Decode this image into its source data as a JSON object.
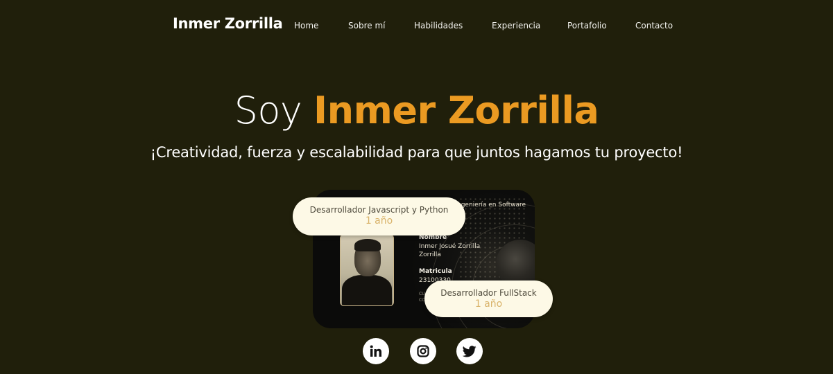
{
  "header": {
    "brand": "Inmer Zorrilla",
    "nav": [
      {
        "label": "Home"
      },
      {
        "label": "Sobre mí"
      },
      {
        "label": "Habilidades"
      },
      {
        "label": "Experiencia"
      },
      {
        "label": "Portafolio"
      },
      {
        "label": "Contacto"
      }
    ]
  },
  "hero": {
    "title_prefix": "Soy",
    "title_name": "Inmer Zorrilla",
    "subtitle": "¡Creatividad, fuerza y escalabilidad para que juntos hagamos tu proyecto!"
  },
  "id_card": {
    "header_text": "ngeniería en Software",
    "name_label": "Nombre",
    "name_value": "Inmer Josué Zorrilla Zorrilla",
    "matricula_label": "Matricula",
    "matricula_value": "23100330",
    "extra_line_1": "CU",
    "extra_line_2": "CC"
  },
  "experience_pills": [
    {
      "title": "Desarrollador Javascript y Python",
      "years": "1 año"
    },
    {
      "title": "Desarrollador FullStack",
      "years": "1 año"
    }
  ],
  "social": [
    {
      "icon": "linkedin-icon"
    },
    {
      "icon": "instagram-icon"
    },
    {
      "icon": "twitter-icon"
    }
  ],
  "colors": {
    "background": "#201f0b",
    "accent": "#eb9a22",
    "pill_background": "#fdf9e6",
    "pill_years": "#d9b36a"
  }
}
